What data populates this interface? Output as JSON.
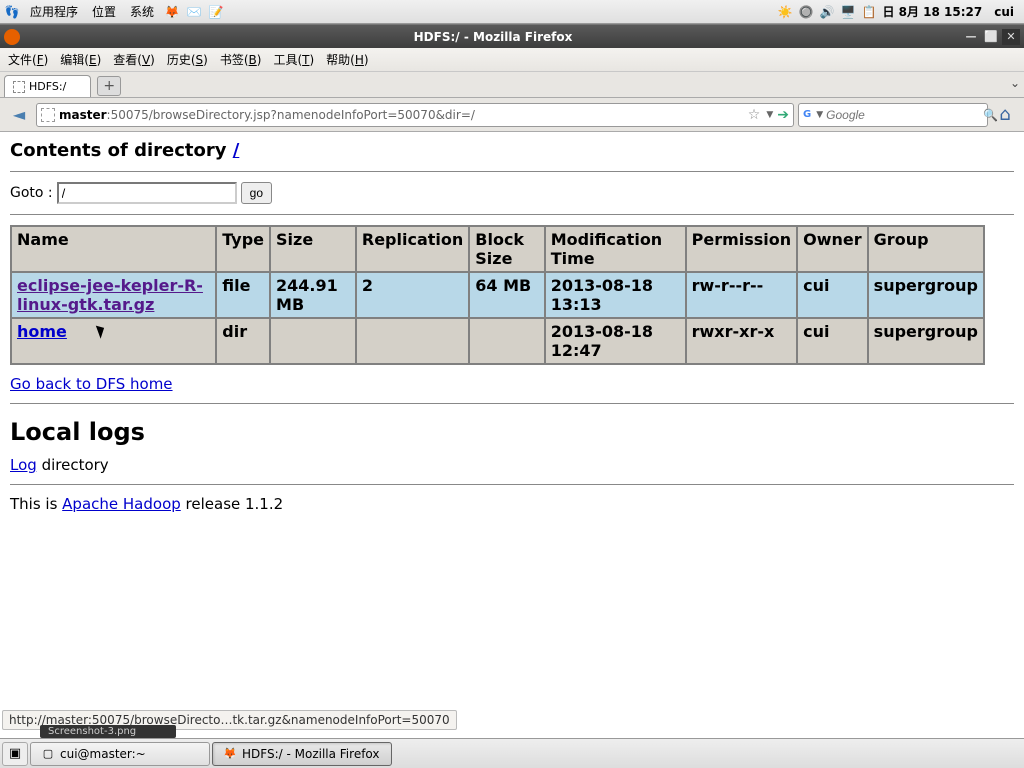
{
  "panel": {
    "menu_apps": "应用程序",
    "menu_places": "位置",
    "menu_system": "系统",
    "clock": "日 8月 18 15:27",
    "user": "cui"
  },
  "window": {
    "title": "HDFS:/ - Mozilla Firefox"
  },
  "menubar": {
    "file": "文件(F)",
    "edit": "编辑(E)",
    "view": "查看(V)",
    "history": "历史(S)",
    "bookmarks": "书签(B)",
    "tools": "工具(T)",
    "help": "帮助(H)"
  },
  "tab": {
    "label": "HDFS:/"
  },
  "url": {
    "host": "master",
    "rest": ":50075/browseDirectory.jsp?namenodeInfoPort=50070&dir=/"
  },
  "search": {
    "placeholder": "Google"
  },
  "page": {
    "heading_prefix": "Contents of directory ",
    "heading_link": "/",
    "goto_label": "Goto : ",
    "goto_value": "/",
    "go_btn": "go",
    "headers": {
      "name": "Name",
      "type": "Type",
      "size": "Size",
      "rep": "Replication",
      "block": "Block Size",
      "mod": "Modification Time",
      "perm": "Permission",
      "owner": "Owner",
      "group": "Group"
    },
    "rows": [
      {
        "name": "eclipse-jee-kepler-R-linux-gtk.tar.gz",
        "type": "file",
        "size": "244.91 MB",
        "rep": "2",
        "block": "64 MB",
        "mod": "2013-08-18 13:13",
        "perm": "rw-r--r--",
        "owner": "cui",
        "group": "supergroup"
      },
      {
        "name": "home",
        "type": "dir",
        "size": "",
        "rep": "",
        "block": "",
        "mod": "2013-08-18 12:47",
        "perm": "rwxr-xr-x",
        "owner": "cui",
        "group": "supergroup"
      }
    ],
    "back_link": "Go back to DFS home",
    "local_logs": "Local logs",
    "log_link": "Log",
    "log_suffix": " directory",
    "release_prefix": "This is ",
    "release_link": "Apache Hadoop",
    "release_suffix": " release 1.1.2"
  },
  "status": "http://master:50075/browseDirecto…tk.tar.gz&namenodeInfoPort=50070",
  "taskbar": {
    "screenshot_strip": "Screenshot-3.png",
    "term": "cui@master:~",
    "ff": "HDFS:/ - Mozilla Firefox"
  }
}
